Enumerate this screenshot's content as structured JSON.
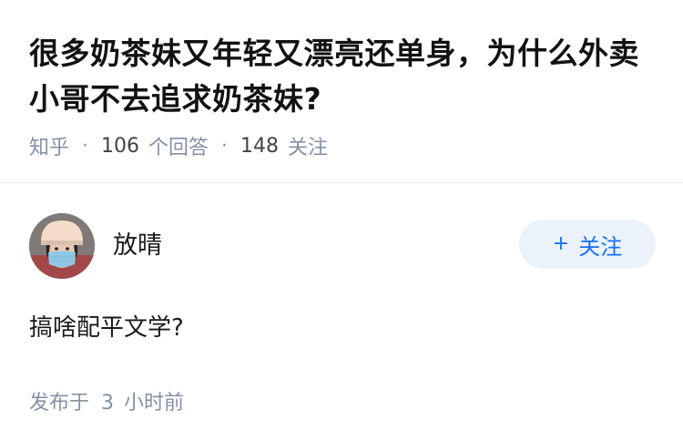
{
  "question": {
    "title": "很多奶茶妹又年轻又漂亮还单身，为什么外卖小哥不去追求奶茶妹?",
    "source": "知乎",
    "answers_count": "106",
    "answers_unit": "个回答",
    "followers_count": "148",
    "followers_unit": "关注"
  },
  "answer": {
    "author_name": "放晴",
    "follow_label": "关注",
    "follow_prefix": "+",
    "content": "搞啥配平文学?",
    "time_prefix": "发布于",
    "time_value": "3",
    "time_suffix": "小时前"
  }
}
